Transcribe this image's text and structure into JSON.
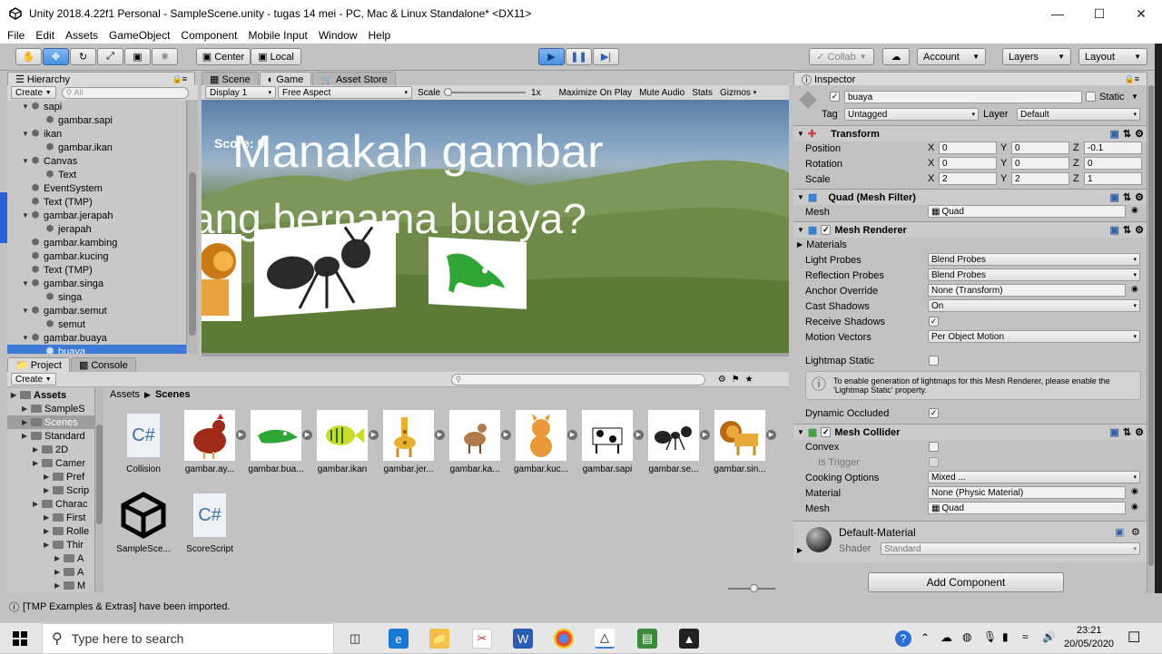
{
  "window": {
    "title": "Unity 2018.4.22f1 Personal - SampleScene.unity - tugas 14 mei - PC, Mac & Linux Standalone* <DX11>"
  },
  "menu": [
    "File",
    "Edit",
    "Assets",
    "GameObject",
    "Component",
    "Mobile Input",
    "Window",
    "Help"
  ],
  "toolbar": {
    "center": "Center",
    "local": "Local",
    "collab": "Collab",
    "account": "Account",
    "layers": "Layers",
    "layout": "Layout"
  },
  "hierarchy": {
    "tab": "Hierarchy",
    "create": "Create",
    "search_placeholder": "All",
    "items": [
      {
        "label": "sapi",
        "indent": 1,
        "expanded": true
      },
      {
        "label": "gambar.sapi",
        "indent": 2
      },
      {
        "label": "ikan",
        "indent": 1,
        "expanded": true
      },
      {
        "label": "gambar.ikan",
        "indent": 2
      },
      {
        "label": "Canvas",
        "indent": 1,
        "expanded": true
      },
      {
        "label": "Text",
        "indent": 2
      },
      {
        "label": "EventSystem",
        "indent": 1
      },
      {
        "label": "Text (TMP)",
        "indent": 1
      },
      {
        "label": "gambar.jerapah",
        "indent": 1,
        "expanded": true
      },
      {
        "label": "jerapah",
        "indent": 2
      },
      {
        "label": "gambar.kambing",
        "indent": 1
      },
      {
        "label": "gambar.kucing",
        "indent": 1
      },
      {
        "label": "Text (TMP)",
        "indent": 1
      },
      {
        "label": "gambar.singa",
        "indent": 1,
        "expanded": true
      },
      {
        "label": "singa",
        "indent": 2
      },
      {
        "label": "gambar.semut",
        "indent": 1,
        "expanded": true
      },
      {
        "label": "semut",
        "indent": 2
      },
      {
        "label": "gambar.buaya",
        "indent": 1,
        "expanded": true
      },
      {
        "label": "buaya",
        "indent": 2,
        "selected": true
      }
    ]
  },
  "game": {
    "tabs": [
      "Scene",
      "Game",
      "Asset Store"
    ],
    "display": "Display 1",
    "aspect": "Free Aspect",
    "scale_label": "Scale",
    "scale_value": "1x",
    "maximize": "Maximize On Play",
    "mute": "Mute Audio",
    "stats": "Stats",
    "gizmos": "Gizmos",
    "score": "Score: 0",
    "question_line1": "Manakah gambar",
    "question_line2": "yang bernama buaya?"
  },
  "project": {
    "tabs": [
      "Project",
      "Console"
    ],
    "create": "Create",
    "breadcrumb": [
      "Assets",
      "Scenes"
    ],
    "tree": [
      {
        "label": "Assets",
        "indent": 0,
        "bold": true
      },
      {
        "label": "SampleS",
        "indent": 1
      },
      {
        "label": "Scenes",
        "indent": 1,
        "selected": true
      },
      {
        "label": "Standard",
        "indent": 1
      },
      {
        "label": "2D",
        "indent": 2
      },
      {
        "label": "Camer",
        "indent": 2
      },
      {
        "label": "Pref",
        "indent": 3
      },
      {
        "label": "Scrip",
        "indent": 3
      },
      {
        "label": "Charac",
        "indent": 2
      },
      {
        "label": "First",
        "indent": 3
      },
      {
        "label": "Rolle",
        "indent": 3
      },
      {
        "label": "Thir",
        "indent": 3
      },
      {
        "label": "A",
        "indent": 4
      },
      {
        "label": "A",
        "indent": 4
      },
      {
        "label": "M",
        "indent": 4
      }
    ],
    "assets": [
      {
        "label": "Collision",
        "kind": "cs"
      },
      {
        "label": "gambar.ay...",
        "kind": "chicken"
      },
      {
        "label": "gambar.bua...",
        "kind": "croc"
      },
      {
        "label": "gambar.ikan",
        "kind": "fish"
      },
      {
        "label": "gambar.jer...",
        "kind": "giraffe"
      },
      {
        "label": "gambar.ka...",
        "kind": "goat"
      },
      {
        "label": "gambar.kuc...",
        "kind": "cat"
      },
      {
        "label": "gambar.sapi",
        "kind": "cow"
      },
      {
        "label": "gambar.se...",
        "kind": "ant"
      },
      {
        "label": "gambar.sin...",
        "kind": "lion"
      },
      {
        "label": "SampleSce...",
        "kind": "unity"
      },
      {
        "label": "ScoreScript",
        "kind": "cs"
      }
    ]
  },
  "inspector": {
    "tab": "Inspector",
    "name": "buaya",
    "static_label": "Static",
    "tag_label": "Tag",
    "tag_value": "Untagged",
    "layer_label": "Layer",
    "layer_value": "Default",
    "transform": {
      "title": "Transform",
      "rows": [
        {
          "label": "Position",
          "x": "0",
          "y": "0",
          "z": "-0.1"
        },
        {
          "label": "Rotation",
          "x": "0",
          "y": "0",
          "z": "0"
        },
        {
          "label": "Scale",
          "x": "2",
          "y": "2",
          "z": "1"
        }
      ]
    },
    "mesh_filter": {
      "title": "Quad (Mesh Filter)",
      "mesh_label": "Mesh",
      "mesh_value": "Quad"
    },
    "mesh_renderer": {
      "title": "Mesh Renderer",
      "materials": "Materials",
      "light_probes_label": "Light Probes",
      "light_probes": "Blend Probes",
      "reflection_probes_label": "Reflection Probes",
      "reflection_probes": "Blend Probes",
      "anchor_label": "Anchor Override",
      "anchor": "None (Transform)",
      "cast_label": "Cast Shadows",
      "cast": "On",
      "receive_label": "Receive Shadows",
      "motion_label": "Motion Vectors",
      "motion": "Per Object Motion",
      "lightmap_label": "Lightmap Static",
      "info": "To enable generation of lightmaps for this Mesh Renderer, please enable the 'Lightmap Static' property.",
      "occluded_label": "Dynamic Occluded"
    },
    "mesh_collider": {
      "title": "Mesh Collider",
      "convex_label": "Convex",
      "trigger_label": "Is Trigger",
      "cooking_label": "Cooking Options",
      "cooking": "Mixed ...",
      "material_label": "Material",
      "material": "None (Physic Material)",
      "mesh_label": "Mesh",
      "mesh": "Quad"
    },
    "material": {
      "name": "Default-Material",
      "shader_label": "Shader",
      "shader": "Standard"
    },
    "add_component": "Add Component"
  },
  "status": {
    "message": "[TMP Examples & Extras] have been imported."
  },
  "taskbar": {
    "search_placeholder": "Type here to search",
    "time": "23:21",
    "date": "20/05/2020"
  },
  "colors": {
    "selection": "#3d7ad6",
    "play_active": "#4a8fe0"
  }
}
